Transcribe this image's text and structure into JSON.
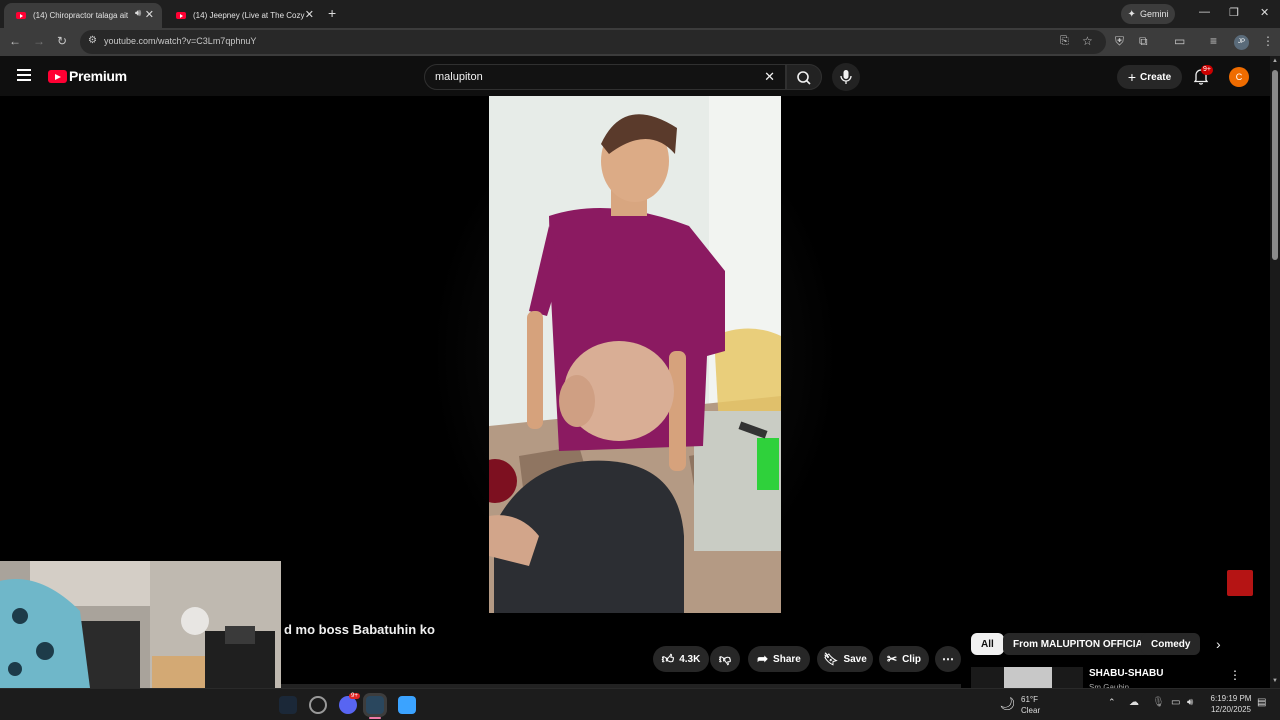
{
  "browser": {
    "tabs": [
      {
        "title": "(14) Chiropractor talaga ait",
        "active": true
      },
      {
        "title": "(14) Jeepney (Live at The Cozy C",
        "active": false
      }
    ],
    "gemini_label": "Gemini",
    "url": "youtube.com/watch?v=C3Lm7qphnuY",
    "extension_badge": "JP"
  },
  "youtube": {
    "logo_text": "Premium",
    "search_query": "malupiton",
    "create_label": "Create",
    "notification_count": "9+",
    "avatar_letter": "C"
  },
  "video": {
    "title_partial": "d mo boss Babatuhin ko",
    "like_count": "4.3K",
    "share_label": "Share",
    "save_label": "Save",
    "clip_label": "Clip"
  },
  "sidebar": {
    "chips": [
      "All",
      "From MALUPITON OFFICIAL",
      "Comedy"
    ],
    "next_video_title": "SHABU-SHABU",
    "next_video_channel": "Sm Gaubin"
  },
  "taskbar": {
    "weather_temp": "61°F",
    "weather_desc": "Clear",
    "time": "6:19:19 PM",
    "date": "12/20/2025",
    "discord_badge": "9+"
  },
  "colors": {
    "youtube_red": "#ff0033",
    "avatar_orange": "#ef6c00",
    "badge_red": "#cc0000"
  }
}
